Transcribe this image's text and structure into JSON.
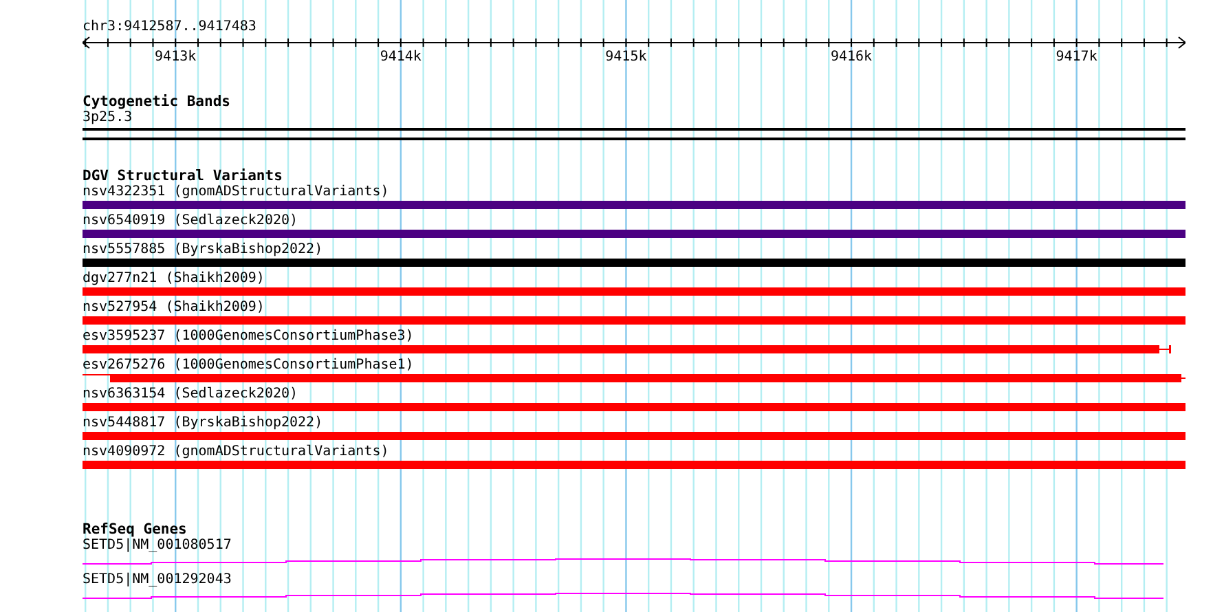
{
  "position": "chr3:9412587..9417483",
  "ruler": {
    "ticks": [
      "9413k",
      "9414k",
      "9415k",
      "9416k",
      "9417k"
    ]
  },
  "cytogenetic_bands": {
    "title": "Cytogenetic Bands",
    "band": "3p25.3"
  },
  "dgv": {
    "title": "DGV Structural Variants",
    "variants": [
      {
        "label": "nsv4322351 (gnomADStructuralVariants)",
        "color": "#4b0082",
        "kind": "full"
      },
      {
        "label": "nsv6540919 (Sedlazeck2020)",
        "color": "#4b0082",
        "kind": "full"
      },
      {
        "label": "nsv5557885 (ByrskaBishop2022)",
        "color": "#000000",
        "kind": "full"
      },
      {
        "label": "dgv277n21 (Shaikh2009)",
        "color": "#ff0000",
        "kind": "full"
      },
      {
        "label": "nsv527954 (Shaikh2009)",
        "color": "#ff0000",
        "kind": "full"
      },
      {
        "label": "esv3595237 (1000GenomesConsortiumPhase3)",
        "color": "#ff0000",
        "kind": "short"
      },
      {
        "label": "esv2675276 (1000GenomesConsortiumPhase1)",
        "color": "#ff0000",
        "kind": "tailed"
      },
      {
        "label": "nsv6363154 (Sedlazeck2020)",
        "color": "#ff0000",
        "kind": "full"
      },
      {
        "label": "nsv5448817 (ByrskaBishop2022)",
        "color": "#ff0000",
        "kind": "full"
      },
      {
        "label": "nsv4090972 (gnomADStructuralVariants)",
        "color": "#ff0000",
        "kind": "full"
      }
    ]
  },
  "refseq": {
    "title": "RefSeq Genes",
    "genes": [
      {
        "label": "SETD5|NM_001080517"
      },
      {
        "label": "SETD5|NM_001292043"
      }
    ]
  }
}
